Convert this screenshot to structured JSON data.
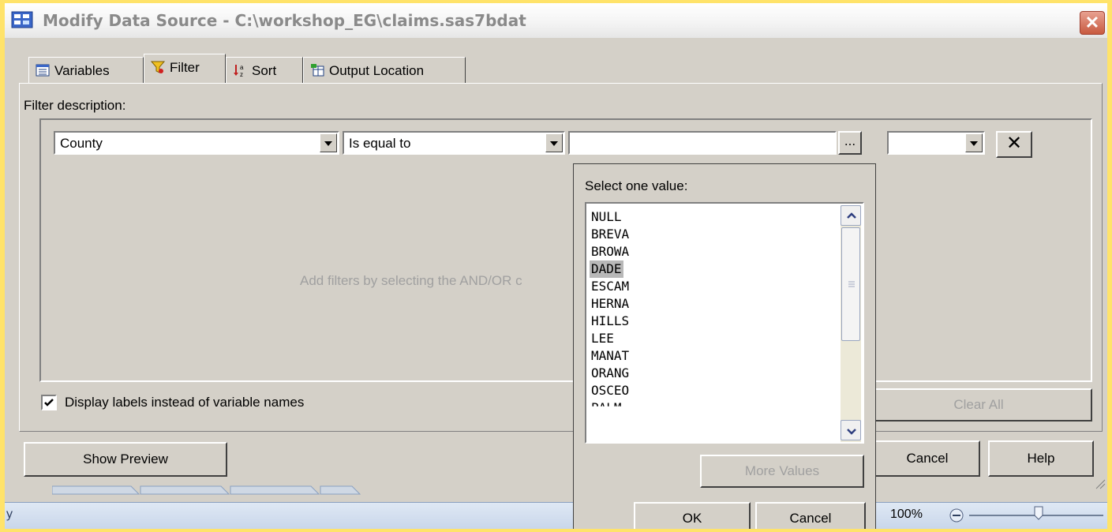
{
  "window": {
    "title": "Modify Data Source - C:\\workshop_EG\\claims.sas7bdat",
    "close_glyph": "✕"
  },
  "tabs": [
    {
      "label": "Variables",
      "icon": "variables-list-icon"
    },
    {
      "label": "Filter",
      "icon": "funnel-icon"
    },
    {
      "label": "Sort",
      "icon": "sort-az-icon"
    },
    {
      "label": "Output Location",
      "icon": "output-table-icon"
    }
  ],
  "filter": {
    "description_label": "Filter description:",
    "column_value": "County",
    "operator_value": "Is equal to",
    "value_field": "",
    "browse_label": "...",
    "connector_value": "",
    "remove_glyph": "✕",
    "hint_text": "Add filters by selecting the AND/OR c",
    "display_labels_checkbox": "Display labels instead of variable names",
    "display_labels_checked": true,
    "clear_all_label": "Clear All"
  },
  "popup": {
    "prompt": "Select one value:",
    "values": [
      "NULL",
      "BREVA",
      "BROWA",
      "DADE",
      "ESCAM",
      "HERNA",
      "HILLS",
      "LEE",
      "MANAT",
      "ORANG",
      "OSCEO",
      "PALM"
    ],
    "selected_value": "DADE",
    "more_values_label": "More Values",
    "ok_label": "OK",
    "cancel_label": "Cancel"
  },
  "footer": {
    "show_preview_label": "Show Preview",
    "cancel_label": "Cancel",
    "help_label": "Help"
  },
  "background_app": {
    "zoom_label": "100%",
    "status_left": "y"
  }
}
